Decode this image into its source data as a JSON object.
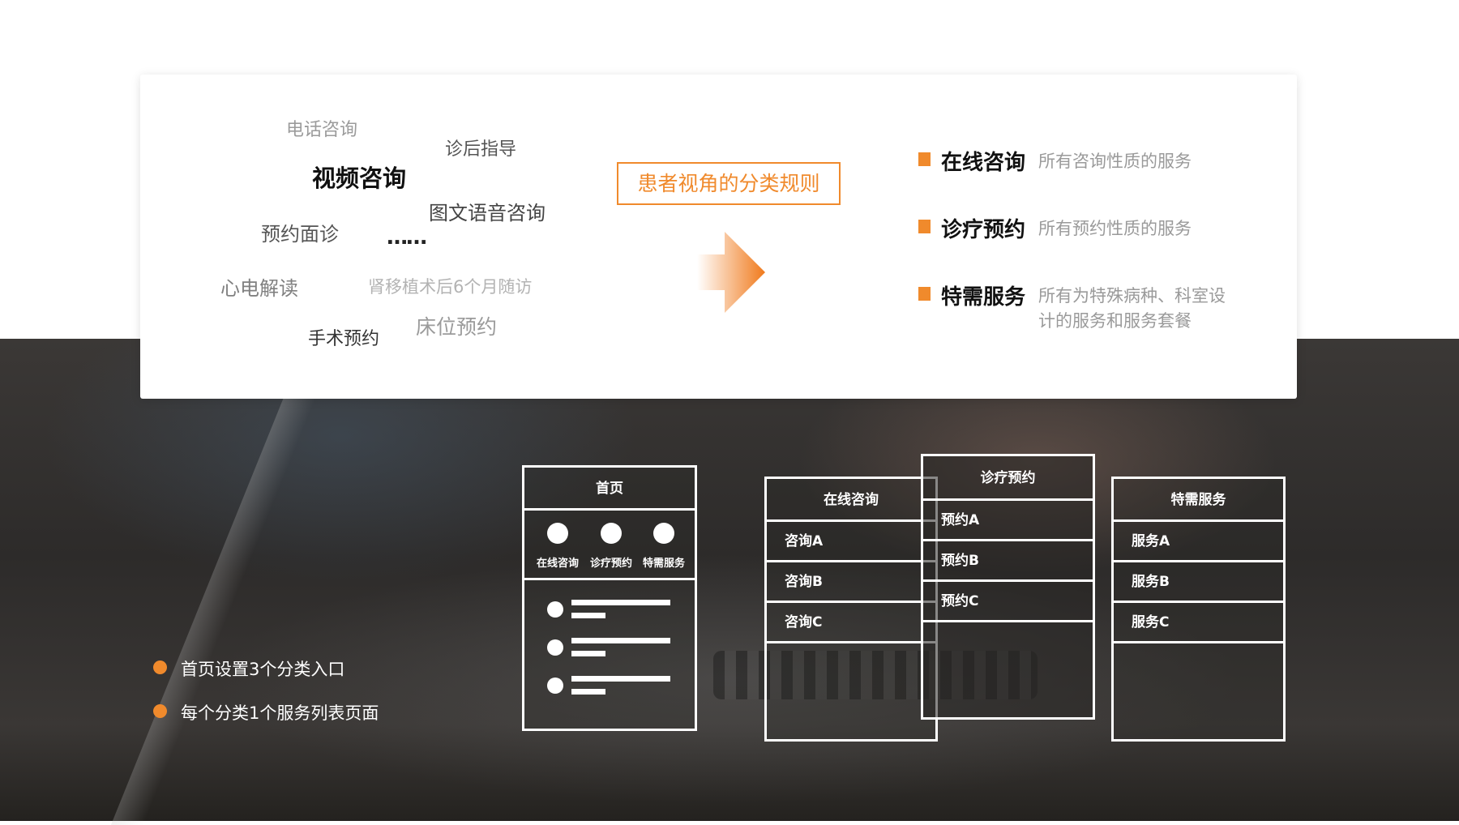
{
  "word_cloud": [
    {
      "text": "电话咨询",
      "color": "#9b9b9b"
    },
    {
      "text": "诊后指导",
      "color": "#555555"
    },
    {
      "text": "视频咨询",
      "color": "#111111"
    },
    {
      "text": "图文语音咨询",
      "color": "#444444"
    },
    {
      "text": "预约面诊",
      "color": "#555555"
    },
    {
      "text": "……",
      "color": "#222222"
    },
    {
      "text": "心电解读",
      "color": "#808080"
    },
    {
      "text": "肾移植术后6个月随访",
      "color": "#b3b3b3"
    },
    {
      "text": "床位预约",
      "color": "#9b9b9b"
    },
    {
      "text": "手术预约",
      "color": "#333333"
    }
  ],
  "rule_label": "患者视角的分类规则",
  "categories": [
    {
      "name": "在线咨询",
      "desc": "所有咨询性质的服务"
    },
    {
      "name": "诊疗预约",
      "desc": "所有预约性质的服务"
    },
    {
      "name": "特需服务",
      "desc": "所有为特殊病种、科室设计的服务和服务套餐"
    }
  ],
  "bullets": [
    "首页设置3个分类入口",
    "每个分类1个服务列表页面"
  ],
  "home_panel": {
    "title": "首页",
    "entries": [
      "在线咨询",
      "诊疗预约",
      "特需服务"
    ]
  },
  "list_panels": [
    {
      "title": "在线咨询",
      "items": [
        "咨询A",
        "咨询B",
        "咨询C"
      ]
    },
    {
      "title": "诊疗预约",
      "items": [
        "预约A",
        "预约B",
        "预约C"
      ]
    },
    {
      "title": "特需服务",
      "items": [
        "服务A",
        "服务B",
        "服务C"
      ]
    }
  ],
  "colors": {
    "accent": "#f08a2c",
    "dark_bg": "#2f2d2b"
  }
}
